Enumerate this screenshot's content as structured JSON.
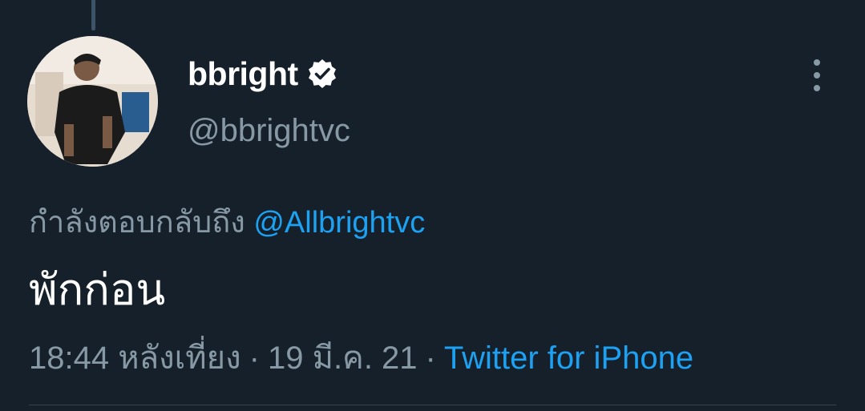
{
  "tweet": {
    "display_name": "bbright",
    "handle": "@bbrightvc",
    "verified": true,
    "reply_prefix": "กำลังตอบกลับถึง",
    "reply_to": "@Allbrightvc",
    "text": "พักก่อน",
    "time": "18:44 หลังเที่ยง",
    "separator": "·",
    "date": "19 มี.ค. 21",
    "source": "Twitter for iPhone"
  },
  "icons": {
    "verified": "verified-badge-icon",
    "more": "more-vertical-icon"
  },
  "colors": {
    "background": "#15202b",
    "primary_text": "#ffffff",
    "secondary_text": "#8899a6",
    "link": "#1da1f2"
  }
}
